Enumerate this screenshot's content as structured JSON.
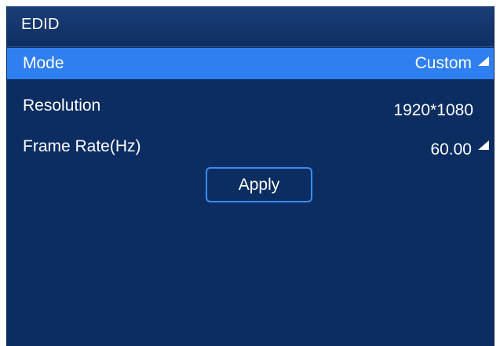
{
  "window": {
    "title": "EDID"
  },
  "settings": [
    {
      "label": "Mode",
      "value": "Custom",
      "has_dropdown": true,
      "selected": true
    },
    {
      "label": "Resolution",
      "value": "1920*1080",
      "has_dropdown": false,
      "selected": false
    },
    {
      "label": "Frame Rate(Hz)",
      "value": "60.00",
      "has_dropdown": true,
      "selected": false
    }
  ],
  "actions": {
    "apply_label": "Apply"
  },
  "colors": {
    "background": "#0b2d62",
    "title_bar": "#1b3e78",
    "selected_row": "#2f7ff0",
    "button_border": "#3a8cf0",
    "text": "#ffffff"
  },
  "icons": {
    "dropdown": "triangle-arrow-icon"
  }
}
